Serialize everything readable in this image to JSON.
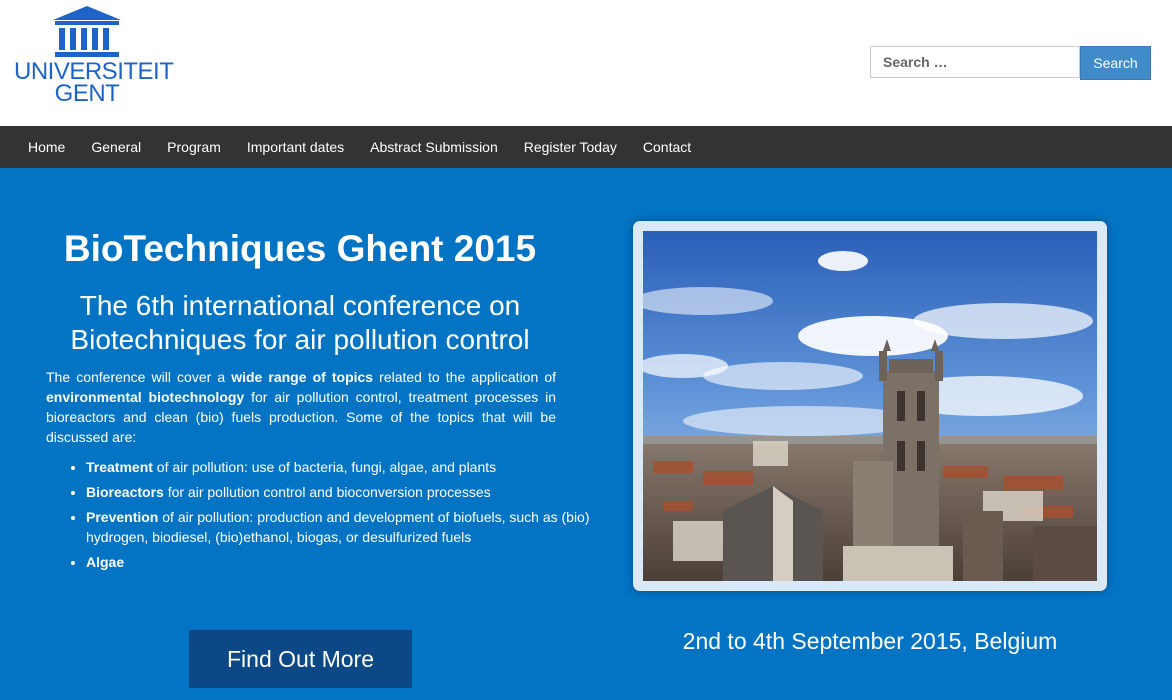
{
  "header": {
    "logo": {
      "line1": "UNIVERSITEIT",
      "line2": "GENT",
      "color": "#1e64c8"
    },
    "search": {
      "placeholder": "Search …",
      "button_label": "Search",
      "button_color": "#428bca"
    }
  },
  "navbar": {
    "background": "#333333",
    "items": [
      "Home",
      "General",
      "Program",
      "Important dates",
      "Abstract Submission",
      "Register Today",
      "Contact"
    ]
  },
  "hero": {
    "background": "#0374c4",
    "title": "BioTechniques Ghent 2015",
    "subtitle_line1": "The 6th international conference on",
    "subtitle_line2": "Biotechniques for air pollution control",
    "description": {
      "part1": "The conference will cover a ",
      "bold1": "wide range of topics",
      "part2": " related to the application of ",
      "bold2": "environmental biotechnology",
      "part3": " for air pollution control, treatment processes in bioreactors and clean (bio) fuels production. Some of the topics that will be discussed are:"
    },
    "topics": [
      {
        "bold": "Treatment",
        "text": " of air pollution: use of bacteria, fungi, algae, and plants"
      },
      {
        "bold": "Bioreactors",
        "text": " for air pollution control and bioconversion processes"
      },
      {
        "bold": "Prevention",
        "text": " of air pollution: production and development of biofuels, such as (bio) hydrogen, biodiesel, (bio)ethanol, biogas, or desulfurized fuels"
      },
      {
        "bold": "Algae",
        "text": ""
      }
    ],
    "cta_label": "Find Out More",
    "cta_color": "#0b4885",
    "date_line": "2nd to 4th September 2015, Belgium"
  }
}
